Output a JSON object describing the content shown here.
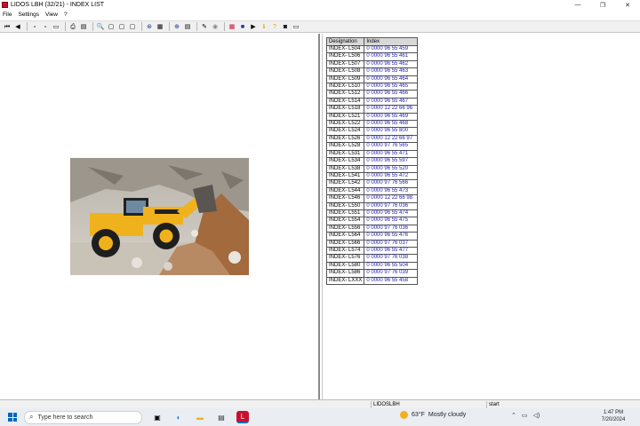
{
  "window": {
    "title": "LIDOS LBH (32/21) - INDEX LIST",
    "minimize": "—",
    "maximize": "❐",
    "close": "✕"
  },
  "menu": [
    "File",
    "Settings",
    "View",
    "?"
  ],
  "index_table": {
    "headers": [
      "Designation",
      "Index"
    ],
    "rows": [
      [
        "INDEX- L504",
        "0 0000 96 55 459"
      ],
      [
        "INDEX- L506",
        "0 0000 96 55 461"
      ],
      [
        "INDEX- L507",
        "0 0000 96 55 462"
      ],
      [
        "INDEX- L508",
        "0 0000 96 55 463"
      ],
      [
        "INDEX- L509",
        "0 0000 96 55 464"
      ],
      [
        "INDEX- L510",
        "0 0000 96 55 465"
      ],
      [
        "INDEX- L512",
        "0 0000 96 55 466"
      ],
      [
        "INDEX- L514",
        "0 0000 96 55 467"
      ],
      [
        "INDEX- L518",
        "0 0000 12 22 66 96"
      ],
      [
        "INDEX- L521",
        "0 0000 96 55 469"
      ],
      [
        "INDEX- L522",
        "0 0000 96 55 468"
      ],
      [
        "INDEX- L524",
        "0 0000 96 55 800"
      ],
      [
        "INDEX- L526",
        "0 0000 12 22 66 97"
      ],
      [
        "INDEX- L528",
        "0 0000 97 76 565"
      ],
      [
        "INDEX- L531",
        "0 0000 96 55 471"
      ],
      [
        "INDEX- L534",
        "0 0000 96 55 597"
      ],
      [
        "INDEX- L538",
        "0 0000 96 55 520"
      ],
      [
        "INDEX- L541",
        "0 0000 96 55 472"
      ],
      [
        "INDEX- L542",
        "0 0000 97 76 566"
      ],
      [
        "INDEX- L544",
        "0 0000 96 55 473"
      ],
      [
        "INDEX- L546",
        "0 0000 12 22 66 98"
      ],
      [
        "INDEX- L550",
        "0 0000 97 76 036"
      ],
      [
        "INDEX- L551",
        "0 0000 96 55 474"
      ],
      [
        "INDEX- L554",
        "0 0000 96 55 475"
      ],
      [
        "INDEX- L556",
        "0 0000 97 76 036"
      ],
      [
        "INDEX- L564",
        "0 0000 96 55 476"
      ],
      [
        "INDEX- L566",
        "0 0000 97 76 037"
      ],
      [
        "INDEX- L574",
        "0 0000 96 55 477"
      ],
      [
        "INDEX- L576",
        "0 0000 97 76 038"
      ],
      [
        "INDEX- L580",
        "0 0000 96 55 504"
      ],
      [
        "INDEX- L586",
        "0 0000 97 76 039"
      ],
      [
        "INDEX- LXXX",
        "0 0000 96 55 458"
      ]
    ]
  },
  "statusbar": {
    "app_name": "LIDOSLBH",
    "state": "start"
  },
  "taskbar": {
    "search_placeholder": "Type here to search",
    "weather_temp": "63°F",
    "weather_desc": "Mostly cloudy",
    "time": "1:47 PM",
    "date": "7/20/2024"
  },
  "colors": {
    "index_link": "#1a1aa8",
    "header_bg": "#d8d8d8",
    "windows_accent": "#0067c0"
  }
}
